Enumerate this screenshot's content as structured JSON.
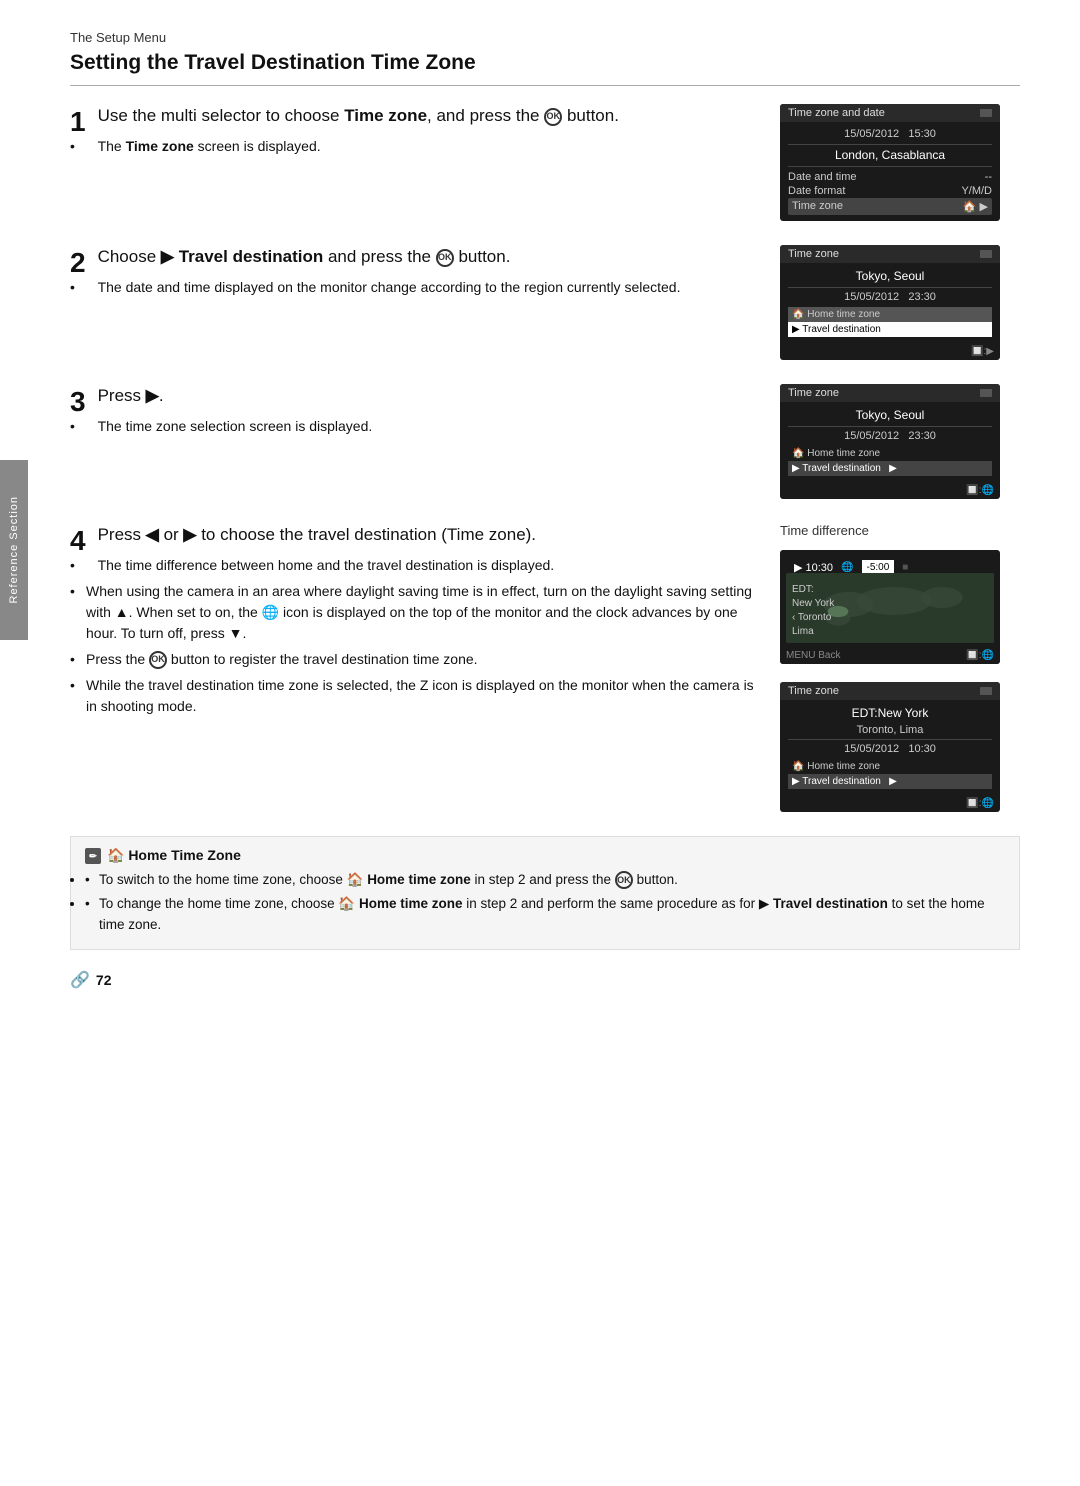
{
  "header": {
    "section": "The Setup Menu"
  },
  "page": {
    "title": "Setting the Travel Destination Time Zone"
  },
  "side_tab": {
    "label": "Reference Section"
  },
  "steps": [
    {
      "number": "1",
      "title_parts": [
        "Use the multi selector to choose ",
        "Time zone",
        ", and press the ",
        "OK",
        " button."
      ],
      "bullets": [
        [
          "The ",
          "Time zone",
          " screen is displayed."
        ]
      ],
      "screen": {
        "title": "Time zone and date",
        "datetime": "15/05/2012  15:30",
        "city": "London, Casablanca",
        "rows": [
          {
            "label": "Date and time",
            "value": "--"
          },
          {
            "label": "Date format",
            "value": "Y/M/D"
          },
          {
            "label": "Time zone",
            "value": "🏠 ▶"
          }
        ]
      }
    },
    {
      "number": "2",
      "title_parts": [
        "Choose ",
        "▶",
        " ",
        "Travel destination",
        " and press the ",
        "OK",
        " button."
      ],
      "bullets": [
        [
          "The date and time displayed on the monitor change according to the region currently selected."
        ]
      ],
      "screen": {
        "title": "Time zone",
        "city": "Tokyo, Seoul",
        "datetime": "15/05/2012  23:30",
        "home_row": "🏠 Home time zone",
        "travel_row": "▶ Travel destination",
        "footer": "🔲:▶"
      }
    },
    {
      "number": "3",
      "title_parts": [
        "Press ",
        "▶",
        "."
      ],
      "bullets": [
        [
          "The time zone selection screen is displayed."
        ]
      ],
      "screen": {
        "title": "Time zone",
        "city": "Tokyo, Seoul",
        "datetime": "15/05/2012  23:30",
        "home_row": "🏠 Home time zone",
        "travel_row": "▶ Travel destination",
        "footer": "🔲:🌐"
      }
    },
    {
      "number": "4",
      "title_parts": [
        "Press ",
        "◀",
        " or ",
        "▶",
        " to choose the travel destination (Time zone)."
      ],
      "bullets": [
        [
          "The time difference between home and the travel destination is displayed."
        ],
        [
          "When using the camera in an area where daylight saving time is in effect, turn on the daylight saving setting with ▲. When set to on, the 🌐 icon is displayed on the top of the monitor and the clock advances by one hour. To turn off, press ▼."
        ],
        [
          "Press the OK button to register the travel destination time zone."
        ],
        [
          "While the travel destination time zone is selected, the Z  icon is displayed on the monitor when the camera is in shooting mode."
        ]
      ],
      "time_diff": {
        "label": "Time difference",
        "time_left": "▶ 10:30",
        "time_right": "-5:00",
        "cities": [
          "EDT:",
          "New York",
          "‹ Toronto",
          "Lima"
        ]
      },
      "screen2": {
        "title": "Time zone",
        "city1": "EDT:New York",
        "city2": "Toronto, Lima",
        "datetime": "15/05/2012  10:30",
        "home_row": "🏠 Home time zone",
        "travel_row": "▶ Travel destination",
        "footer": "🔲:🌐"
      }
    }
  ],
  "note": {
    "title": "🏠 Home Time Zone",
    "bullets": [
      "To switch to the home time zone, choose 🏠 Home time zone in step 2 and press the OK button.",
      "To change the home time zone, choose 🏠 Home time zone in step 2 and perform the same procedure as for ▶ Travel destination to set the home time zone."
    ]
  },
  "footer": {
    "page_ref": "🔗72"
  }
}
